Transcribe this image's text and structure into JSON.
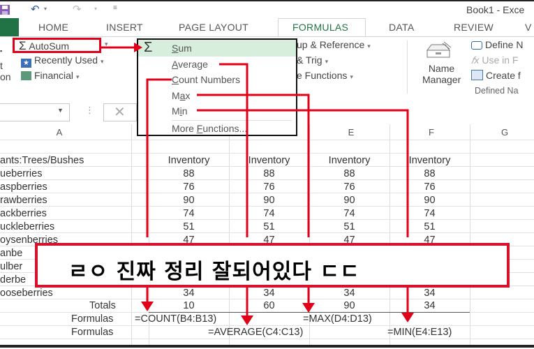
{
  "title_bar": {
    "doc_title": "Book1 - Exce",
    "undo_icon": "undo-icon",
    "redo_icon": "redo-icon",
    "qat_customize_icon": "customize-qat-icon"
  },
  "tabs": [
    {
      "label": "HOME"
    },
    {
      "label": "INSERT"
    },
    {
      "label": "PAGE LAYOUT"
    },
    {
      "label": "FORMULAS",
      "active": true
    },
    {
      "label": "DATA"
    },
    {
      "label": "REVIEW"
    },
    {
      "label": "V"
    }
  ],
  "ribbon": {
    "left_partial": [
      "t",
      "on"
    ],
    "function_library": {
      "autosum": "AutoSum",
      "recently_used": "Recently Used",
      "financial": "Financial",
      "lookup": "up & Reference",
      "math": "& Trig",
      "more_functions": "e Functions"
    },
    "defined_names": {
      "name_manager_line1": "Name",
      "name_manager_line2": "Manager",
      "define_name": "Define N",
      "use_in_formula": "Use in F",
      "create_from": "Create f",
      "group_label": "Defined Na"
    }
  },
  "autosum_menu": {
    "items": [
      {
        "label": "Sum",
        "selected": true
      },
      {
        "label": "Average"
      },
      {
        "label": "Count Numbers"
      },
      {
        "label": "Max"
      },
      {
        "label": "Min"
      },
      {
        "label": "More Functions..."
      }
    ]
  },
  "formula_bar": {
    "namebox_value": "",
    "cancel_icon": "cancel-x-icon"
  },
  "columns": [
    "A",
    "E",
    "F",
    "G"
  ],
  "sheet": {
    "header_row": {
      "a": "ants:Trees/Bushes",
      "b": "Inventory",
      "c": "Inventory",
      "d": "Inventory",
      "e": "Inventory"
    },
    "rows": [
      {
        "a": "ueberries",
        "b": "88",
        "c": "88",
        "d": "88",
        "e": "88"
      },
      {
        "a": "aspberries",
        "b": "76",
        "c": "76",
        "d": "76",
        "e": "76"
      },
      {
        "a": "rawberries",
        "b": "90",
        "c": "90",
        "d": "90",
        "e": "90"
      },
      {
        "a": "ackberries",
        "b": "74",
        "c": "74",
        "d": "74",
        "e": "74"
      },
      {
        "a": "uckleberries",
        "b": "51",
        "c": "51",
        "d": "51",
        "e": "51"
      },
      {
        "a": "oysenberries",
        "b": "47",
        "c": "47",
        "d": "47",
        "e": "47"
      },
      {
        "a": "anbe",
        "b": "",
        "c": "",
        "d": "",
        "e": ""
      },
      {
        "a": "ulber",
        "b": "",
        "c": "",
        "d": "",
        "e": ""
      },
      {
        "a": "derbe",
        "b": "",
        "c": "",
        "d": "",
        "e": ""
      },
      {
        "a": "ooseberries",
        "b": "34",
        "c": "34",
        "d": "34",
        "e": "34"
      }
    ],
    "totals": {
      "label": "Totals",
      "b": "10",
      "c": "60",
      "d": "90",
      "e": "34"
    },
    "formulas1": {
      "label": "Formulas",
      "count": "=COUNT(B4:B13)",
      "max": "=MAX(D4:D13)"
    },
    "formulas2": {
      "label": "Formulas",
      "average": "=AVERAGE(C4:C13)",
      "min": "=MIN(E4:E13)"
    }
  },
  "annotation": {
    "text": "ㄹㅇ 진짜 정리 잘되어있다 ㄷㄷ",
    "border_color": "#d9102c"
  },
  "colors": {
    "accent_green": "#217346",
    "highlight_red": "#e0001a",
    "menu_selected": "#d8eedd"
  }
}
